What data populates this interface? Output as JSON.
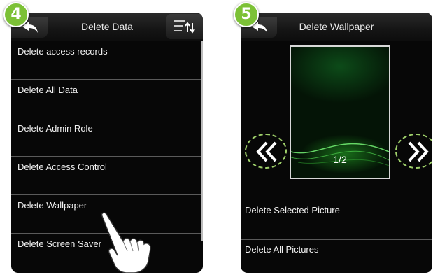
{
  "left_panel": {
    "step_number": "4",
    "title": "Delete Data",
    "menu_items": [
      "Delete access records",
      "Delete All Data",
      "Delete Admin Role",
      "Delete Access Control",
      "Delete Wallpaper",
      "Delete Screen Saver"
    ]
  },
  "right_panel": {
    "step_number": "5",
    "title": "Delete Wallpaper",
    "page_counter": "1/2",
    "actions": [
      "Delete Selected Picture",
      "Delete All Pictures"
    ]
  },
  "colors": {
    "badge_green": "#7cc136",
    "screen_bg": "#070707",
    "dashed_circle": "#9fd06a"
  },
  "icons": [
    "back-arrow-icon",
    "sort-icon",
    "hand-pointer-icon",
    "double-chevron-left-icon",
    "double-chevron-right-icon"
  ]
}
